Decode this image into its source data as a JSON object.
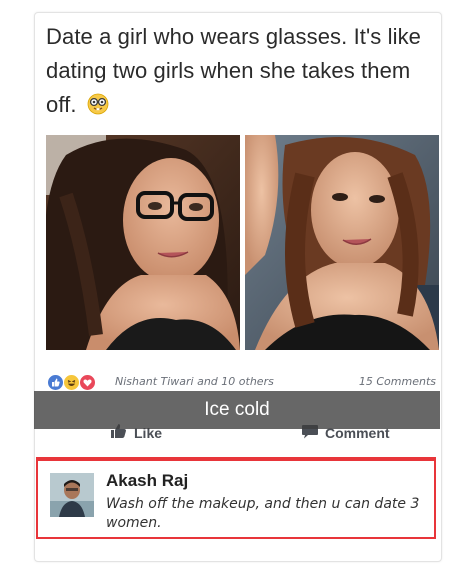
{
  "post": {
    "text": "Date a girl who wears glasses. It's like dating two girls when she takes them off.",
    "emoji_icon": "nerd-face-icon"
  },
  "photos": {
    "left_desc": "selfie-with-glasses",
    "right_desc": "selfie-without-glasses"
  },
  "reactions": {
    "icons": [
      "like-reaction-icon",
      "haha-reaction-icon",
      "love-reaction-icon"
    ],
    "colors": [
      "#4a7bd3",
      "#f6c63b",
      "#e9485a"
    ],
    "reactors": "Nishant Tiwari and 10 others",
    "comments_count": "15 Comments"
  },
  "caption": {
    "text": "Ice cold"
  },
  "actions": {
    "like_label": "Like",
    "comment_label": "Comment"
  },
  "comment": {
    "author": "Akash Raj",
    "text": "Wash off the makeup, and then u can date 3 women."
  },
  "colors": {
    "highlight": "#e8353a",
    "text": "#2b2b2b",
    "muted": "#6a6f78"
  }
}
